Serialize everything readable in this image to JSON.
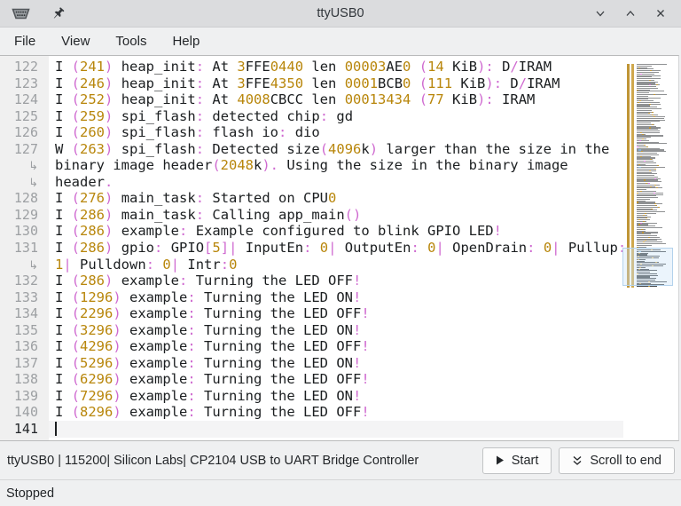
{
  "window": {
    "title": "ttyUSB0"
  },
  "menu": {
    "items": [
      "File",
      "View",
      "Tools",
      "Help"
    ]
  },
  "editor": {
    "wrap_marker": "↳",
    "colors": {
      "number": "#b8860b",
      "punct": "#cf6ad0",
      "text": "#1b1e20",
      "line_number": "#9da0a3"
    },
    "lines": [
      {
        "num": "122",
        "rows": [
          "I (241) heap_init: At 3FFE0440 len 00003AE0 (14 KiB): D/IRAM"
        ]
      },
      {
        "num": "123",
        "rows": [
          "I (246) heap_init: At 3FFE4350 len 0001BCB0 (111 KiB): D/IRAM"
        ]
      },
      {
        "num": "124",
        "rows": [
          "I (252) heap_init: At 4008CBCC len 00013434 (77 KiB): IRAM"
        ]
      },
      {
        "num": "125",
        "rows": [
          "I (259) spi_flash: detected chip: gd"
        ]
      },
      {
        "num": "126",
        "rows": [
          "I (260) spi_flash: flash io: dio"
        ]
      },
      {
        "num": "127",
        "rows": [
          "W (263) spi_flash: Detected size(4096k) larger than the size in the",
          "binary image header(2048k). Using the size in the binary image",
          "header."
        ]
      },
      {
        "num": "128",
        "rows": [
          "I (276) main_task: Started on CPU0"
        ]
      },
      {
        "num": "129",
        "rows": [
          "I (286) main_task: Calling app_main()"
        ]
      },
      {
        "num": "130",
        "rows": [
          "I (286) example: Example configured to blink GPIO LED!"
        ]
      },
      {
        "num": "131",
        "rows": [
          "I (286) gpio: GPIO[5]| InputEn: 0| OutputEn: 0| OpenDrain: 0| Pullup:",
          "1| Pulldown: 0| Intr:0"
        ]
      },
      {
        "num": "132",
        "rows": [
          "I (286) example: Turning the LED OFF!"
        ]
      },
      {
        "num": "133",
        "rows": [
          "I (1296) example: Turning the LED ON!"
        ]
      },
      {
        "num": "134",
        "rows": [
          "I (2296) example: Turning the LED OFF!"
        ]
      },
      {
        "num": "135",
        "rows": [
          "I (3296) example: Turning the LED ON!"
        ]
      },
      {
        "num": "136",
        "rows": [
          "I (4296) example: Turning the LED OFF!"
        ]
      },
      {
        "num": "137",
        "rows": [
          "I (5296) example: Turning the LED ON!"
        ]
      },
      {
        "num": "138",
        "rows": [
          "I (6296) example: Turning the LED OFF!"
        ]
      },
      {
        "num": "139",
        "rows": [
          "I (7296) example: Turning the LED ON!"
        ]
      },
      {
        "num": "140",
        "rows": [
          "I (8296) example: Turning the LED OFF!"
        ]
      },
      {
        "num": "141",
        "rows": [
          ""
        ],
        "current": true
      }
    ]
  },
  "infobar": {
    "device_label": "ttyUSB0 | 115200| Silicon Labs| CP2104 USB to UART Bridge Controller",
    "start_label": "Start",
    "scroll_label": "Scroll to end"
  },
  "statusbar": {
    "text": "Stopped"
  }
}
